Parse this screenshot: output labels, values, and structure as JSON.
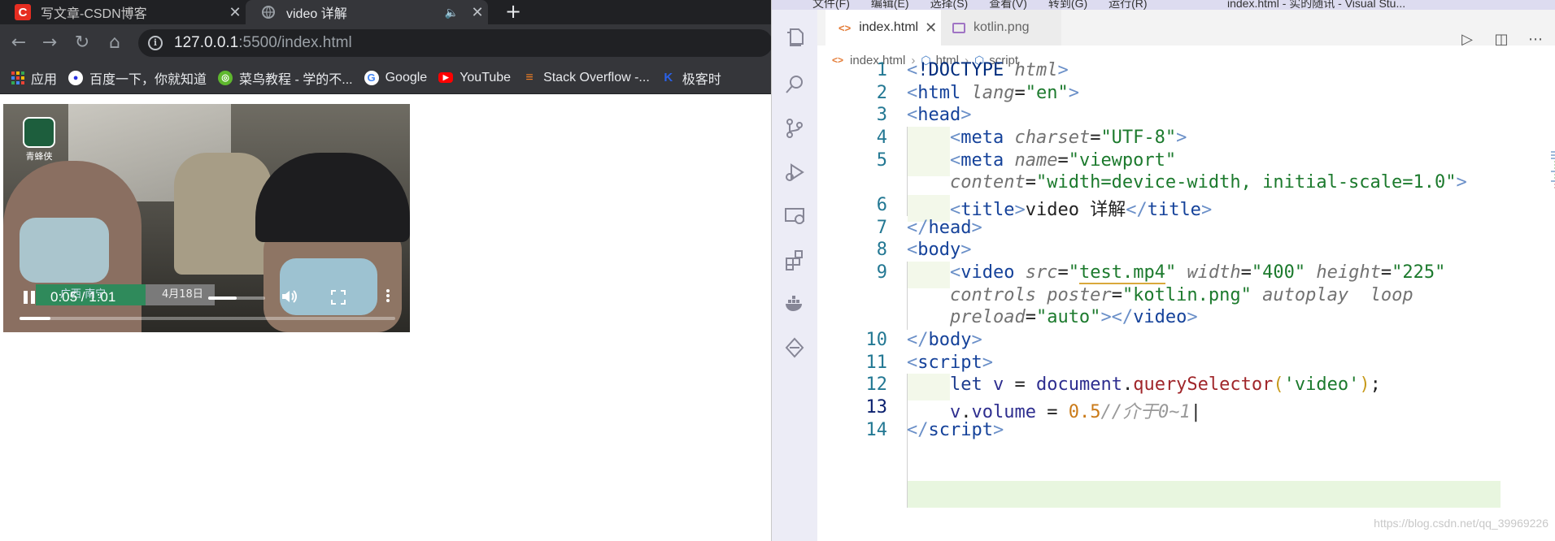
{
  "browser": {
    "tabs": [
      {
        "title": "写文章-CSDN博客",
        "icon": "csdn-icon"
      },
      {
        "title": "video 详解",
        "icon": "globe-icon",
        "audio": "speaker-icon"
      }
    ],
    "url_host": "127.0.0.1",
    "url_rest": ":5500/index.html",
    "bookmarks": [
      {
        "label": "应用",
        "icon": "apps-grid-icon"
      },
      {
        "label": "百度一下，你就知道",
        "icon": "baidu-icon"
      },
      {
        "label": "菜鸟教程 - 学的不...",
        "icon": "runoob-icon"
      },
      {
        "label": "Google",
        "icon": "google-icon"
      },
      {
        "label": "YouTube",
        "icon": "youtube-icon"
      },
      {
        "label": "Stack Overflow -...",
        "icon": "stackoverflow-icon"
      },
      {
        "label": "极客时",
        "icon": "jike-icon"
      }
    ],
    "video": {
      "time": "0:05 / 1:01",
      "progress": 0.082,
      "volume": 0.5,
      "logo_text": "青蜂侠",
      "strip_left": "广西 南宁",
      "strip_right": "4月18日"
    }
  },
  "vscode": {
    "menu": [
      "文件(F)",
      "编辑(E)",
      "选择(S)",
      "查看(V)",
      "转到(G)",
      "运行(R)"
    ],
    "window_title": "index.html - 实的随讯 - Visual Stu...",
    "tabs": [
      {
        "label": "index.html",
        "active": true
      },
      {
        "label": "kotlin.png",
        "active": false
      }
    ],
    "breadcrumb": [
      "index.html",
      "html",
      "script"
    ],
    "line_numbers": [
      "1",
      "2",
      "3",
      "4",
      "5",
      "",
      "6",
      "7",
      "8",
      "9",
      "",
      "",
      "10",
      "11",
      "12",
      "13",
      "14"
    ],
    "current_line": "13",
    "watermark": "https://blog.csdn.net/qq_39969226"
  },
  "colors": {
    "csdn_red": "#e62d21",
    "code_line_highlight": "#e8f6df"
  }
}
